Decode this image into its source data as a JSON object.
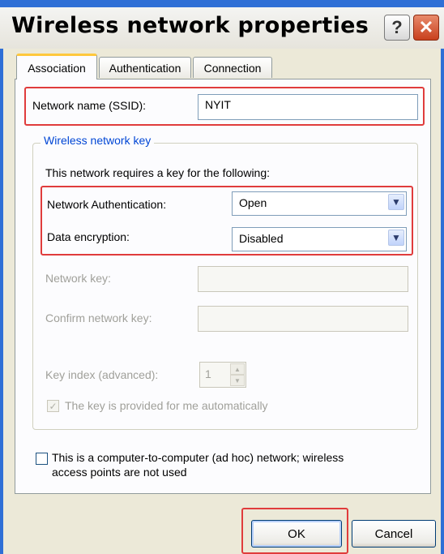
{
  "window": {
    "title": "Wireless network properties",
    "help_glyph": "?",
    "close_glyph": "✕"
  },
  "tabs": [
    {
      "label": "Association",
      "active": true
    },
    {
      "label": "Authentication",
      "active": false
    },
    {
      "label": "Connection",
      "active": false
    }
  ],
  "ssid": {
    "label": "Network name (SSID):",
    "value": "NYIT"
  },
  "key_group": {
    "legend": "Wireless network key",
    "description": "This network requires a key for the following:",
    "auth_label": "Network Authentication:",
    "auth_value": "Open",
    "encryption_label": "Data encryption:",
    "encryption_value": "Disabled",
    "network_key_label": "Network key:",
    "confirm_key_label": "Confirm network key:",
    "key_index_label": "Key index (advanced):",
    "key_index_value": "1",
    "auto_key_label": "The key is provided for me automatically",
    "auto_key_checked": true
  },
  "adhoc": {
    "label_line1": "This is a computer-to-computer (ad hoc) network; wireless",
    "label_line2": "access points are not used",
    "checked": false
  },
  "buttons": {
    "ok": "OK",
    "cancel": "Cancel"
  },
  "colors": {
    "accent_blue": "#2f6fd6",
    "highlight_red": "#e03c3c",
    "legend_blue": "#0046d5"
  }
}
